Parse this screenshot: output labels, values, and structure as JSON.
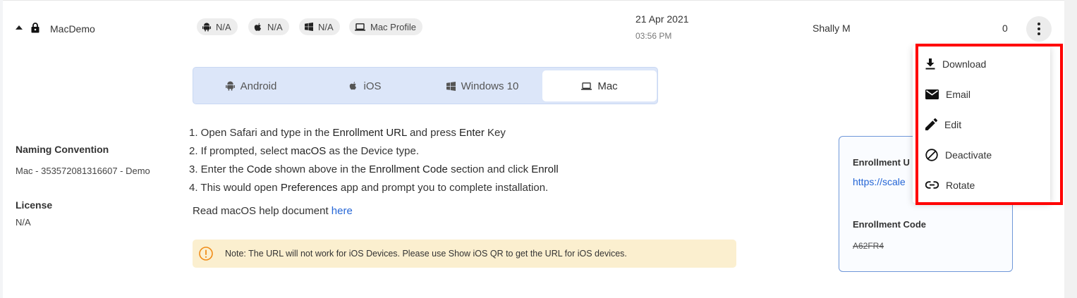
{
  "row": {
    "name": "MacDemo",
    "platform_chips": [
      {
        "icon": "android-icon",
        "label": "N/A"
      },
      {
        "icon": "apple-icon",
        "label": "N/A"
      },
      {
        "icon": "windows-icon",
        "label": "N/A"
      },
      {
        "icon": "laptop-icon",
        "label": "Mac Profile"
      }
    ],
    "date": "21 Apr 2021",
    "time": "03:56 PM",
    "owner": "Shally M",
    "count": "0"
  },
  "tabs": [
    {
      "icon": "android-icon",
      "label": "Android",
      "active": false
    },
    {
      "icon": "apple-icon",
      "label": "iOS",
      "active": false
    },
    {
      "icon": "windows-icon",
      "label": "Windows 10",
      "active": false
    },
    {
      "icon": "laptop-icon",
      "label": "Mac",
      "active": true
    }
  ],
  "meta": {
    "naming_label": "Naming Convention",
    "naming_value": "Mac - 353572081316607 - Demo",
    "license_label": "License",
    "license_value": "N/A"
  },
  "steps": {
    "s1": {
      "a": "1. Open Safari and type in the ",
      "b": "Enrollment URL",
      "c": " and press ",
      "d": "Enter",
      "e": " Key"
    },
    "s2": {
      "a": "2. If prompted, select ",
      "b": "macOS",
      "c": " as the Device type."
    },
    "s3": {
      "a": "3. Enter the ",
      "b": "Code",
      "c": " shown above in the ",
      "d": "Enrollment Code",
      "e": " section and click ",
      "f": "Enroll"
    },
    "s4": {
      "a": "4. This would open ",
      "b": "Preferences",
      "c": " app and prompt you to complete installation."
    }
  },
  "help": {
    "text": "Read macOS help document ",
    "link": "here"
  },
  "note": "Note: The URL will not work for iOS Devices. Please use Show iOS QR to get the URL for iOS devices.",
  "enrollment": {
    "url_label": "Enrollment U",
    "url_value": "https://scale",
    "code_label": "Enrollment Code",
    "code_value": "A62FR4"
  },
  "menu": [
    {
      "icon": "download-icon",
      "label": "Download"
    },
    {
      "icon": "email-icon",
      "label": "Email"
    },
    {
      "icon": "edit-icon",
      "label": "Edit"
    },
    {
      "icon": "deactivate-icon",
      "label": "Deactivate"
    },
    {
      "icon": "rotate-icon",
      "label": "Rotate"
    }
  ],
  "colors": {
    "accent": "#2566d6",
    "highlight": "#ff0000",
    "note_bg": "#fbefcf",
    "tabs_bg": "#dce6f9"
  }
}
